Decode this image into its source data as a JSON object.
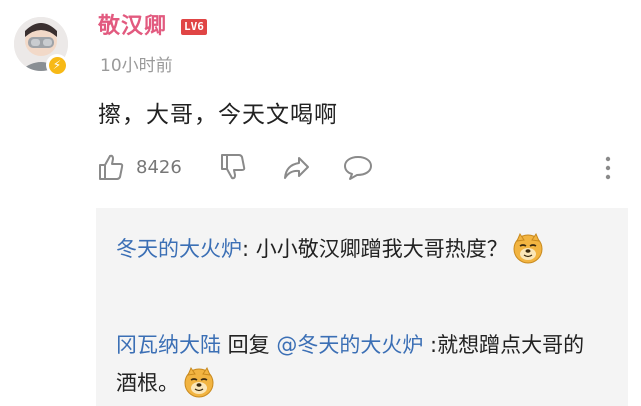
{
  "comment": {
    "username": "敬汉卿",
    "level": "LV6",
    "timestamp": "10小时前",
    "text": "擦，大哥，今天文喝啊",
    "avatar_badge": "⚡",
    "like_count": "8426"
  },
  "replies": [
    {
      "author": "冬天的大火炉",
      "colon": ": ",
      "text": "小小敬汉卿蹭我大哥热度？",
      "emoji": "doge-emoji"
    },
    {
      "author": "冈瓦纳大陆",
      "reply_word": " 回复 ",
      "mention": "@冬天的大火炉",
      "colon": " :",
      "text": "就想蹭点大哥的酒根。",
      "emoji": "doge-emoji"
    }
  ],
  "icons": {
    "like": "thumbs-up-icon",
    "dislike": "thumbs-down-icon",
    "share": "share-arrow-icon",
    "reply": "speech-bubble-icon",
    "more": "vertical-dots-icon"
  },
  "colors": {
    "username": "#e25a7f",
    "link": "#3b6fb5",
    "level_badge": "#e04545",
    "meta_gray": "#9a9a9a",
    "reply_background": "#f4f4f4"
  }
}
